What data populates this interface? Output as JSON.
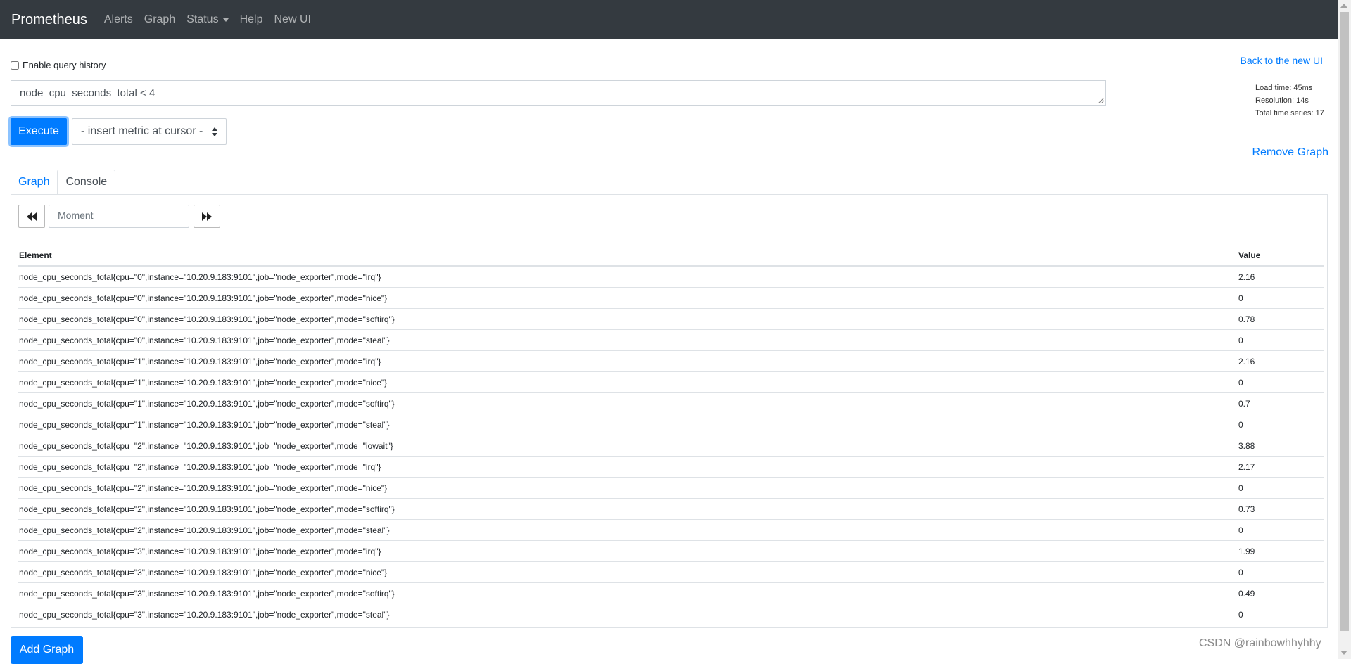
{
  "navbar": {
    "brand": "Prometheus",
    "links": [
      "Alerts",
      "Graph",
      "Status",
      "Help",
      "New UI"
    ]
  },
  "query_history_label": "Enable query history",
  "back_link": "Back to the new UI",
  "expression": "node_cpu_seconds_total < 4",
  "stats": {
    "load_time": "Load time: 45ms",
    "resolution": "Resolution: 14s",
    "total_series": "Total time series: 17"
  },
  "execute_label": "Execute",
  "metric_select": "- insert metric at cursor -",
  "remove_graph": "Remove Graph",
  "tabs": {
    "graph": "Graph",
    "console": "Console"
  },
  "moment_placeholder": "Moment",
  "table": {
    "headers": {
      "element": "Element",
      "value": "Value"
    },
    "rows": [
      {
        "element": "node_cpu_seconds_total{cpu=\"0\",instance=\"10.20.9.183:9101\",job=\"node_exporter\",mode=\"irq\"}",
        "value": "2.16"
      },
      {
        "element": "node_cpu_seconds_total{cpu=\"0\",instance=\"10.20.9.183:9101\",job=\"node_exporter\",mode=\"nice\"}",
        "value": "0"
      },
      {
        "element": "node_cpu_seconds_total{cpu=\"0\",instance=\"10.20.9.183:9101\",job=\"node_exporter\",mode=\"softirq\"}",
        "value": "0.78"
      },
      {
        "element": "node_cpu_seconds_total{cpu=\"0\",instance=\"10.20.9.183:9101\",job=\"node_exporter\",mode=\"steal\"}",
        "value": "0"
      },
      {
        "element": "node_cpu_seconds_total{cpu=\"1\",instance=\"10.20.9.183:9101\",job=\"node_exporter\",mode=\"irq\"}",
        "value": "2.16"
      },
      {
        "element": "node_cpu_seconds_total{cpu=\"1\",instance=\"10.20.9.183:9101\",job=\"node_exporter\",mode=\"nice\"}",
        "value": "0"
      },
      {
        "element": "node_cpu_seconds_total{cpu=\"1\",instance=\"10.20.9.183:9101\",job=\"node_exporter\",mode=\"softirq\"}",
        "value": "0.7"
      },
      {
        "element": "node_cpu_seconds_total{cpu=\"1\",instance=\"10.20.9.183:9101\",job=\"node_exporter\",mode=\"steal\"}",
        "value": "0"
      },
      {
        "element": "node_cpu_seconds_total{cpu=\"2\",instance=\"10.20.9.183:9101\",job=\"node_exporter\",mode=\"iowait\"}",
        "value": "3.88"
      },
      {
        "element": "node_cpu_seconds_total{cpu=\"2\",instance=\"10.20.9.183:9101\",job=\"node_exporter\",mode=\"irq\"}",
        "value": "2.17"
      },
      {
        "element": "node_cpu_seconds_total{cpu=\"2\",instance=\"10.20.9.183:9101\",job=\"node_exporter\",mode=\"nice\"}",
        "value": "0"
      },
      {
        "element": "node_cpu_seconds_total{cpu=\"2\",instance=\"10.20.9.183:9101\",job=\"node_exporter\",mode=\"softirq\"}",
        "value": "0.73"
      },
      {
        "element": "node_cpu_seconds_total{cpu=\"2\",instance=\"10.20.9.183:9101\",job=\"node_exporter\",mode=\"steal\"}",
        "value": "0"
      },
      {
        "element": "node_cpu_seconds_total{cpu=\"3\",instance=\"10.20.9.183:9101\",job=\"node_exporter\",mode=\"irq\"}",
        "value": "1.99"
      },
      {
        "element": "node_cpu_seconds_total{cpu=\"3\",instance=\"10.20.9.183:9101\",job=\"node_exporter\",mode=\"nice\"}",
        "value": "0"
      },
      {
        "element": "node_cpu_seconds_total{cpu=\"3\",instance=\"10.20.9.183:9101\",job=\"node_exporter\",mode=\"softirq\"}",
        "value": "0.49"
      },
      {
        "element": "node_cpu_seconds_total{cpu=\"3\",instance=\"10.20.9.183:9101\",job=\"node_exporter\",mode=\"steal\"}",
        "value": "0"
      }
    ]
  },
  "add_graph": "Add Graph",
  "watermark": "CSDN @rainbowhhyhhy",
  "colors": {
    "navbar": "#343a40",
    "primary": "#007bff",
    "link": "#007bff"
  }
}
